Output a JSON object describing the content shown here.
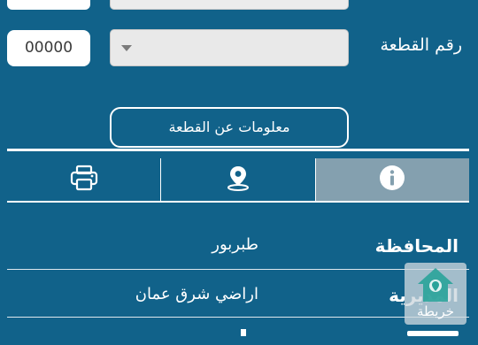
{
  "parcel_number": {
    "label": "رقم القطعة",
    "value": "00000"
  },
  "parcel_info_button": "معلومات عن القطعة",
  "tabs": [
    {
      "name": "print",
      "icon": "printer-icon",
      "active": false
    },
    {
      "name": "location",
      "icon": "map-pin-icon",
      "active": false
    },
    {
      "name": "info",
      "icon": "info-icon",
      "active": true
    }
  ],
  "details": [
    {
      "label": "المحافظة",
      "value": "طبربور"
    },
    {
      "label": "المديرية",
      "value": "اراضي شرق عمان"
    }
  ],
  "map_badge": {
    "label": "خريطة"
  },
  "colors": {
    "background": "#11628a",
    "active_tab": "#84a0af",
    "badge_house": "#2aa39a"
  }
}
